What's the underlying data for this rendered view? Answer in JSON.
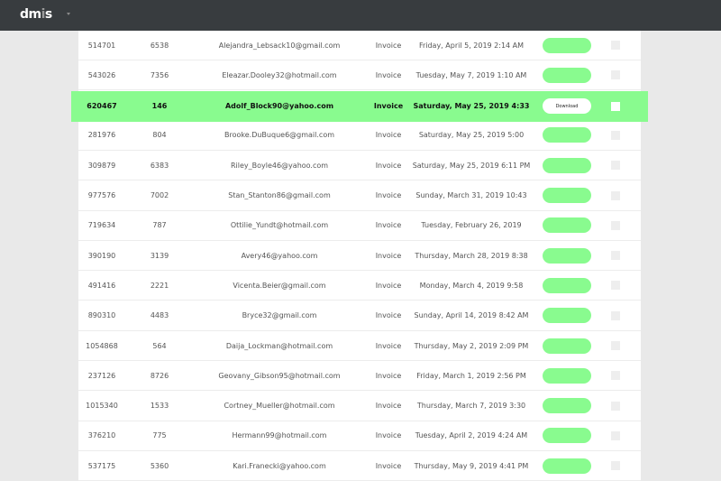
{
  "brand": {
    "logo_main": "dm",
    "logo_mid": "i",
    "logo_end": "s"
  },
  "active_row_index": 2,
  "download_label": "Download",
  "rows": [
    {
      "id": "514701",
      "num": "6538",
      "email": "Alejandra_Lebsack10@gmail.com",
      "type": "Invoice",
      "date": "Friday, April 5, 2019 2:14 AM"
    },
    {
      "id": "543026",
      "num": "7356",
      "email": "Eleazar.Dooley32@hotmail.com",
      "type": "Invoice",
      "date": "Tuesday, May 7, 2019 1:10 AM"
    },
    {
      "id": "620467",
      "num": "146",
      "email": "Adolf_Block90@yahoo.com",
      "type": "Invoice",
      "date": "Saturday, May 25, 2019 4:33"
    },
    {
      "id": "281976",
      "num": "804",
      "email": "Brooke.DuBuque6@gmail.com",
      "type": "Invoice",
      "date": "Saturday, May 25, 2019 5:00"
    },
    {
      "id": "309879",
      "num": "6383",
      "email": "Riley_Boyle46@yahoo.com",
      "type": "Invoice",
      "date": "Saturday, May 25, 2019 6:11 PM"
    },
    {
      "id": "977576",
      "num": "7002",
      "email": "Stan_Stanton86@gmail.com",
      "type": "Invoice",
      "date": "Sunday, March 31, 2019 10:43"
    },
    {
      "id": "719634",
      "num": "787",
      "email": "Ottilie_Yundt@hotmail.com",
      "type": "Invoice",
      "date": "Tuesday, February 26, 2019"
    },
    {
      "id": "390190",
      "num": "3139",
      "email": "Avery46@yahoo.com",
      "type": "Invoice",
      "date": "Thursday, March 28, 2019 8:38"
    },
    {
      "id": "491416",
      "num": "2221",
      "email": "Vicenta.Beier@gmail.com",
      "type": "Invoice",
      "date": "Monday, March 4, 2019 9:58"
    },
    {
      "id": "890310",
      "num": "4483",
      "email": "Bryce32@gmail.com",
      "type": "Invoice",
      "date": "Sunday, April 14, 2019 8:42 AM"
    },
    {
      "id": "1054868",
      "num": "564",
      "email": "Daija_Lockman@hotmail.com",
      "type": "Invoice",
      "date": "Thursday, May 2, 2019 2:09 PM"
    },
    {
      "id": "237126",
      "num": "8726",
      "email": "Geovany_Gibson95@hotmail.com",
      "type": "Invoice",
      "date": "Friday, March 1, 2019 2:56 PM"
    },
    {
      "id": "1015340",
      "num": "1533",
      "email": "Cortney_Mueller@hotmail.com",
      "type": "Invoice",
      "date": "Thursday, March 7, 2019 3:30"
    },
    {
      "id": "376210",
      "num": "775",
      "email": "Hermann99@hotmail.com",
      "type": "Invoice",
      "date": "Tuesday, April 2, 2019 4:24 AM"
    },
    {
      "id": "537175",
      "num": "5360",
      "email": "Kari.Franecki@yahoo.com",
      "type": "Invoice",
      "date": "Thursday, May 9, 2019 4:41 PM"
    }
  ],
  "colors": {
    "topbar": "#383c3f",
    "accent": "#89fb8f",
    "background": "#e9e9e9"
  }
}
